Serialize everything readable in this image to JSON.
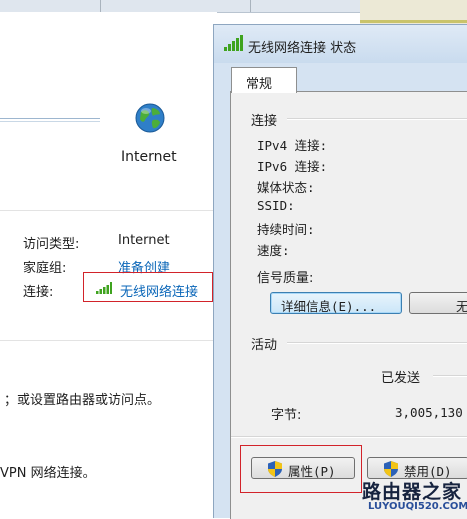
{
  "background": {
    "internet_label": "Internet",
    "access_type_label": "访问类型:",
    "access_type_value": "Internet",
    "homegroup_label": "家庭组:",
    "homegroup_value": "准备创建",
    "connection_label": "连接:",
    "connection_value": "无线网络连接",
    "text_1": "；或设置路由器或访问点。",
    "text_2": "VPN 网络连接。"
  },
  "dialog": {
    "title": "无线网络连接 状态",
    "tab_general": "常规",
    "section_connection": "连接",
    "fields": [
      "IPv4 连接:",
      "IPv6 连接:",
      "媒体状态:",
      "SSID:",
      "持续时间:",
      "速度:"
    ],
    "signal_quality_label": "信号质量:",
    "details_button": "详细信息(E)...",
    "wireless_button": "无",
    "section_activity": "活动",
    "sent_label": "已发送",
    "bytes_label": "字节:",
    "bytes_sent": "3,005,130",
    "properties_button": "属性(P)",
    "disable_button": "禁用(D)"
  },
  "watermark": {
    "top": "路由器之家",
    "bottom": "LUYOUQI520.COM"
  },
  "colors": {
    "link": "#0a66b8",
    "highlight": "#d2232a",
    "signal": "#3fa31f"
  }
}
